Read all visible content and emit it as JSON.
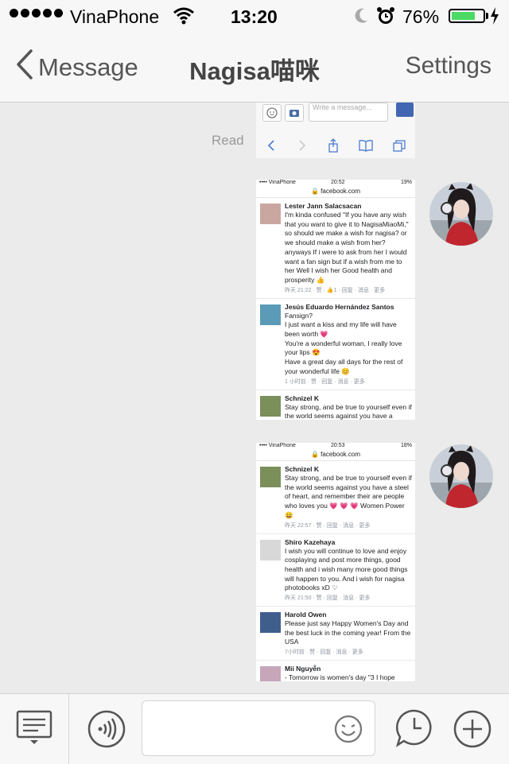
{
  "status_bar": {
    "carrier": "VinaPhone",
    "time": "13:20",
    "battery_percent": "76%",
    "battery_level": 0.76,
    "battery_color": "#4cd964"
  },
  "nav": {
    "back_label": "Message",
    "title": "Nagisa喵咪",
    "settings_label": "Settings"
  },
  "chat": {
    "read_label": "Read",
    "shot1": {
      "input_placeholder": "Write a message..."
    },
    "shot2": {
      "carrier": "•••• VinaPhone",
      "time": "20:52",
      "battery": "19%",
      "url": "🔒 facebook.com",
      "comments": [
        {
          "name": "Lester Jann Salacsacan",
          "text": "I'm kinda confused \"If you have any wish that you want to give it to NagisaMiaoMi,\" so should we make a wish for nagisa? or we should make a wish from her? anyways If i were to ask from her I would want a fan sign but if a wish from me to her Well I wish her Good health and prosperity 👍",
          "meta": "昨天 21:22 · 赞 · 👍1 · 回复 · 消息 · 更多"
        },
        {
          "name": "Jesús Eduardo Hernández Santos",
          "text": "Fansign?\nI just want a kiss and my life will have been worth 💗\nYou're a wonderful woman, I really love your lips 😍\nHave a great day all days for the rest of your wonderful life 😊",
          "meta": "1 小时前 · 赞 · 回复 · 消息 · 更多"
        },
        {
          "name": "Schnizel K",
          "text": "Stay strong, and be true to yourself even if the world seems against you have a",
          "meta": ""
        }
      ]
    },
    "shot3": {
      "carrier": "•••• VinaPhone",
      "time": "20:53",
      "battery": "18%",
      "url": "🔒 facebook.com",
      "comments": [
        {
          "name": "Schnizel K",
          "text": "Stay strong, and be true to yourself even if the world seems against you have a steel of heart, and remember their are people who loves you 💗 💗 💗 Women Power 😀",
          "meta": "昨天 22:57 · 赞 · 回复 · 消息 · 更多"
        },
        {
          "name": "Shiro Kazehaya",
          "text": "I wish you will continue to love and enjoy cosplaying and post more things, good health and i wish many more good things will happen to you. And i wish for nagisa photobooks xD ♡",
          "meta": "昨天 21:50 · 赞 · 回复 · 消息 · 更多"
        },
        {
          "name": "Harold Owen",
          "text": "Please just say Happy Women's Day and the best luck in the coming year! From the USA",
          "meta": "7小时前 · 赞 · 回复 · 消息 · 更多"
        },
        {
          "name": "Mii Nguyễn",
          "text": "- Tomorrow is women's day \"3 I hope",
          "meta": ""
        }
      ]
    }
  },
  "bottom_bar": {
    "menu_icon": "keyboard-menu-icon",
    "voice_icon": "voice-icon",
    "emoji_icon": "smiley-icon",
    "timer_icon": "clock-bubble-icon",
    "add_icon": "plus-icon"
  }
}
